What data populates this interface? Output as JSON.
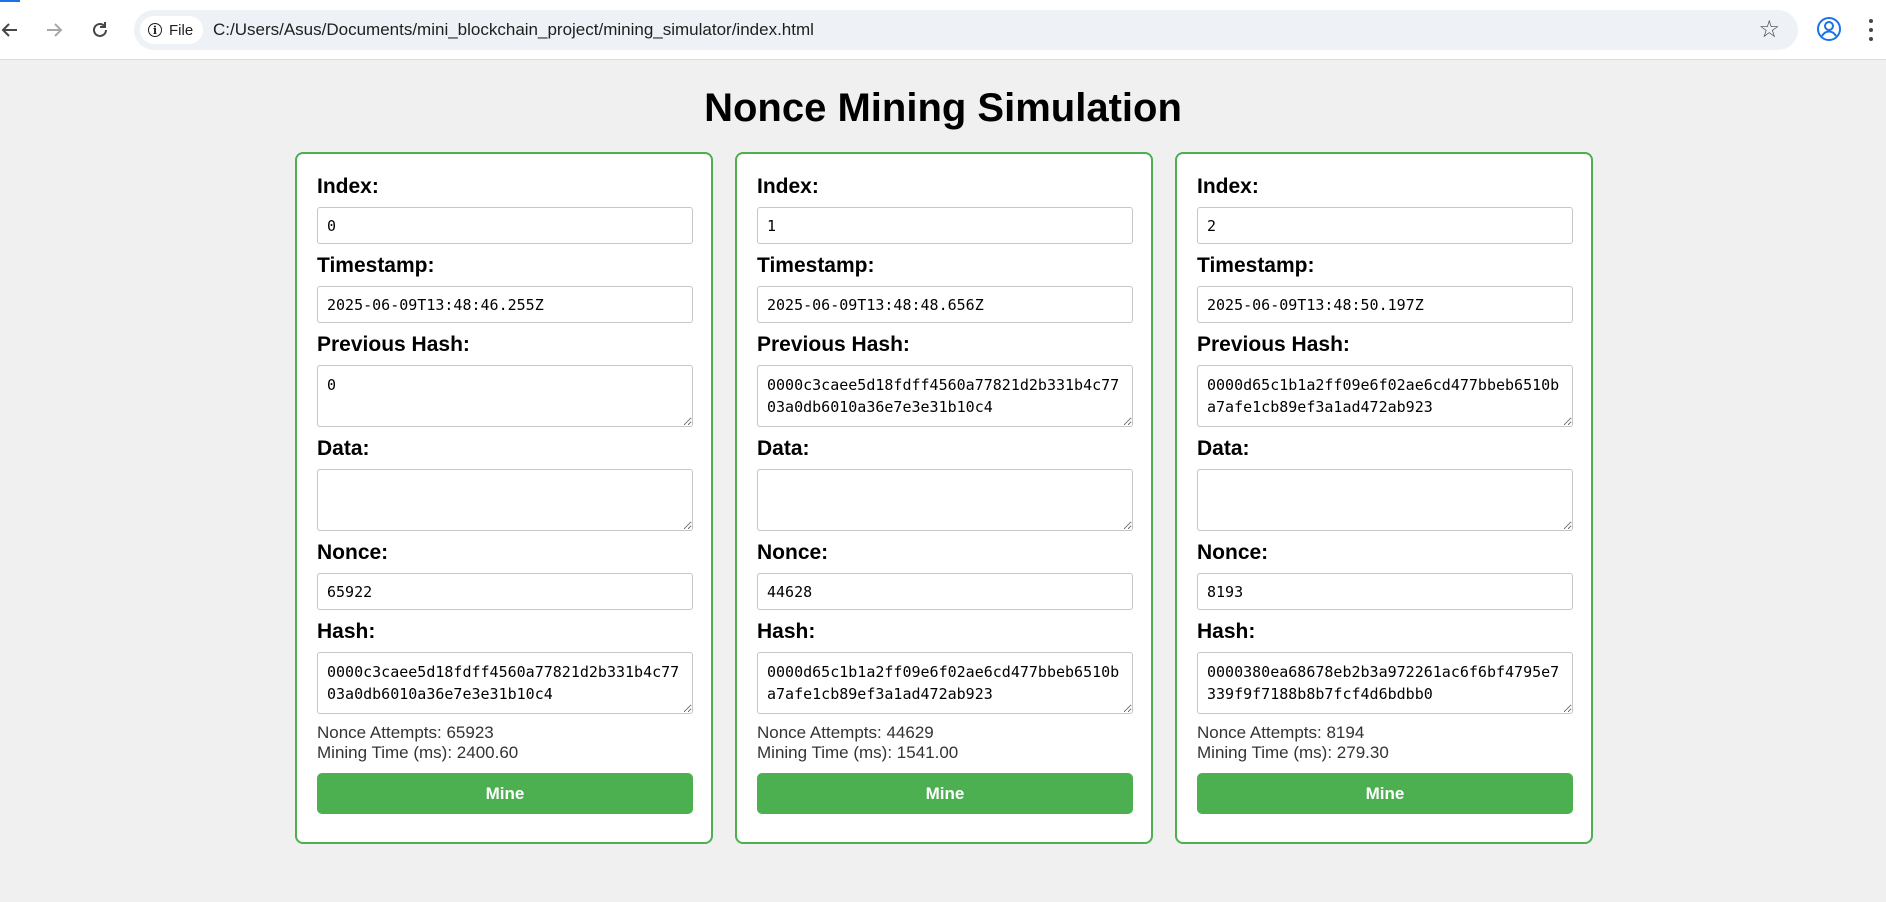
{
  "browser": {
    "chip_label": "File",
    "url": "C:/Users/Asus/Documents/mini_blockchain_project/mining_simulator/index.html",
    "icons": [
      "back-arrow-icon",
      "forward-arrow-icon",
      "reload-icon",
      "info-icon",
      "star-icon",
      "profile-icon",
      "more-vert-icon"
    ]
  },
  "page": {
    "title": "Nonce Mining Simulation",
    "accent_color": "#4caf50"
  },
  "labels": {
    "index": "Index:",
    "timestamp": "Timestamp:",
    "previous_hash": "Previous Hash:",
    "data": "Data:",
    "nonce": "Nonce:",
    "hash": "Hash:",
    "nonce_attempts": "Nonce Attempts:",
    "mining_time": "Mining Time (ms):",
    "mine_button": "Mine"
  },
  "blocks": [
    {
      "index": "0",
      "timestamp": "2025-06-09T13:48:46.255Z",
      "previous_hash": "0",
      "data": "",
      "nonce": "65922",
      "hash": "0000c3caee5d18fdff4560a77821d2b331b4c7703a0db6010a36e7e3e31b10c4",
      "nonce_attempts": "Nonce Attempts: 65923",
      "mining_time": "Mining Time (ms): 2400.60"
    },
    {
      "index": "1",
      "timestamp": "2025-06-09T13:48:48.656Z",
      "previous_hash": "0000c3caee5d18fdff4560a77821d2b331b4c7703a0db6010a36e7e3e31b10c4",
      "data": "",
      "nonce": "44628",
      "hash": "0000d65c1b1a2ff09e6f02ae6cd477bbeb6510ba7afe1cb89ef3a1ad472ab923",
      "nonce_attempts": "Nonce Attempts: 44629",
      "mining_time": "Mining Time (ms): 1541.00"
    },
    {
      "index": "2",
      "timestamp": "2025-06-09T13:48:50.197Z",
      "previous_hash": "0000d65c1b1a2ff09e6f02ae6cd477bbeb6510ba7afe1cb89ef3a1ad472ab923",
      "data": "",
      "nonce": "8193",
      "hash": "0000380ea68678eb2b3a972261ac6f6bf4795e7339f9f7188b8b7fcf4d6bdbb0",
      "nonce_attempts": "Nonce Attempts: 8194",
      "mining_time": "Mining Time (ms): 279.30"
    }
  ]
}
